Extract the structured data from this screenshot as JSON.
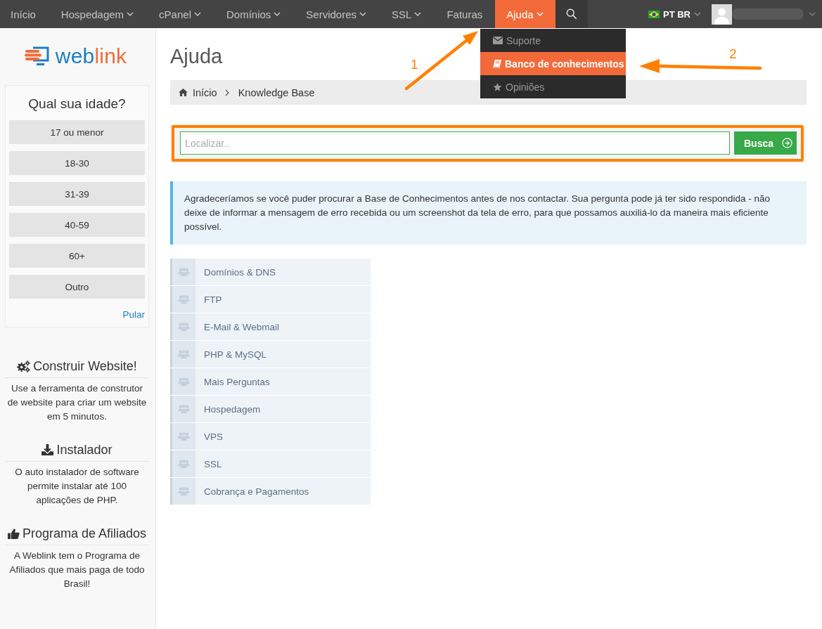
{
  "nav": {
    "items": [
      {
        "label": "Início",
        "has_menu": false,
        "selected": false
      },
      {
        "label": "Hospedagem",
        "has_menu": true,
        "selected": false
      },
      {
        "label": "cPanel",
        "has_menu": true,
        "selected": false
      },
      {
        "label": "Domínios",
        "has_menu": true,
        "selected": false
      },
      {
        "label": "Servidores",
        "has_menu": true,
        "selected": false
      },
      {
        "label": "SSL",
        "has_menu": true,
        "selected": false
      },
      {
        "label": "Faturas",
        "has_menu": false,
        "selected": false
      },
      {
        "label": "Ajuda",
        "has_menu": true,
        "selected": true
      }
    ],
    "language": "PT BR",
    "dropdown": [
      {
        "label": "Suporte",
        "selected": false
      },
      {
        "label": "Banco de conhecimentos",
        "selected": true
      },
      {
        "label": "Opiniões",
        "selected": false
      }
    ]
  },
  "sidebar": {
    "logo": {
      "parts": [
        {
          "text": "web",
          "color": "#1b7fc4"
        },
        {
          "text": "link",
          "color": "#f26b3a"
        }
      ]
    },
    "poll": {
      "title": "Qual sua idade?",
      "options": [
        "17 ou menor",
        "18-30",
        "31-39",
        "40-59",
        "60+",
        "Outro"
      ],
      "skip": "Pular"
    },
    "promos": [
      {
        "title": "Construir Website!",
        "text": "Use a ferramenta de construtor de website para criar um website em 5 minutos."
      },
      {
        "title": "Instalador",
        "text": "O auto instalador de software permite instalar até 100 aplicações de PHP."
      },
      {
        "title": "Programa de Afiliados",
        "text": "A Weblink tem o Programa de Afiliados que mais paga de todo Brasil!"
      }
    ]
  },
  "main": {
    "title": "Ajuda",
    "breadcrumb": [
      "Início",
      "Knowledge Base"
    ],
    "search": {
      "placeholder": "Localizar..",
      "button": "Busca",
      "highlighted": true
    },
    "notice": "Agradeceríamos se você puder procurar a Base de Conhecimentos antes de nos contactar. Sua pergunta pode já ter sido respondida - não deixe de informar a mensagem de erro recebida ou um screenshot da tela de erro, para que possamos auxiliá-lo da maneira mais eficiente possível.",
    "categories": [
      "Domínios & DNS",
      "FTP",
      "E-Mail & Webmail",
      "PHP & MySQL",
      "Mais Perguntas",
      "Hospedagem",
      "VPS",
      "SSL",
      "Cobrança e Pagamentos"
    ]
  },
  "annotations": [
    {
      "label": "1"
    },
    {
      "label": "2"
    }
  ]
}
